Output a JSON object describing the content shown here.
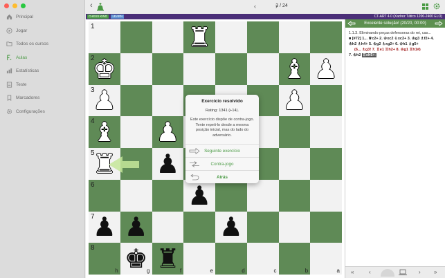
{
  "sidebar": {
    "items": [
      {
        "label": "Principal",
        "icon": "home-icon"
      },
      {
        "label": "Jogar",
        "icon": "play-icon"
      },
      {
        "label": "Todos os cursos",
        "icon": "folder-icon"
      },
      {
        "label": "Aulas",
        "icon": "graduation-icon"
      },
      {
        "label": "Estatísticas",
        "icon": "chart-icon"
      },
      {
        "label": "Teste",
        "icon": "test-icon"
      },
      {
        "label": "Marcadores",
        "icon": "bookmark-icon"
      },
      {
        "label": "Configurações",
        "icon": "gear-icon"
      }
    ],
    "active_index": 3
  },
  "toolbar": {
    "counter": "3 / 24",
    "prev_label": "‹",
    "next_label": "›"
  },
  "header": {
    "badge1": "CHESS KING",
    "badge2": "LEARN",
    "course": "CT-ART 4.0 (Xadrez Tático 1200-2400 ELO)"
  },
  "board": {
    "rank_labels": [
      "1",
      "2",
      "3",
      "4",
      "5",
      "6",
      "7",
      "8"
    ],
    "file_labels": [
      "h",
      "g",
      "f",
      "e",
      "d",
      "c",
      "b",
      "a"
    ],
    "squares": [
      [
        "",
        "",
        "",
        "wR",
        "",
        "",
        "",
        ""
      ],
      [
        "wK",
        "",
        "",
        "",
        "",
        "",
        "wB",
        "wP"
      ],
      [
        "wP",
        "",
        "",
        "",
        "",
        "",
        "wP",
        ""
      ],
      [
        "wB",
        "",
        "wP",
        "",
        "",
        "",
        "",
        ""
      ],
      [
        "wR",
        "",
        "bP",
        "",
        "",
        "",
        "",
        ""
      ],
      [
        "",
        "",
        "",
        "bP",
        "",
        "",
        "",
        ""
      ],
      [
        "bP",
        "bP",
        "",
        "",
        "bP",
        "",
        "",
        ""
      ],
      [
        "",
        "bK",
        "bR",
        "",
        "",
        "",
        "",
        ""
      ]
    ]
  },
  "modal": {
    "title": "Exercício resolvido",
    "rating": "Rating: 1341 (+14).",
    "body": "Este exercício dispõe de contra-jogo. Tente repeti-lo desde a mesma posição inicial, mas do lado do adversário.",
    "next_label": "Seguinte exercício",
    "counter_label": "Contra-jogo",
    "back_label": "Atrás"
  },
  "panel": {
    "banner": "Excelente solução! (20/20, 00:00)",
    "section": "1.1.3. Eliminando peças defensoras do rei, cas...",
    "moves_main": "■ [#72] 1... ♕c2+ 2. ♔xc2 ♘xc2+ 3. ♔g3 ♗f2+ 4. ♔h2 ♗h4+ 5. ♔g2 ♗xg2+ 6. ♔h1 ♗g5+",
    "moves_var": "(6... ♗g3! 7. ♖e1 ♖h2+ 8. ♔g1 ♖h1#)",
    "moves_end_prefix": "7. ♔h2 ",
    "moves_end_highlight": "♖xh5+-"
  },
  "colors": {
    "accent": "#4a9a44",
    "header_purple": "#4b2f78",
    "board_dark": "#5f8a56",
    "board_light": "#f2f2f2"
  }
}
